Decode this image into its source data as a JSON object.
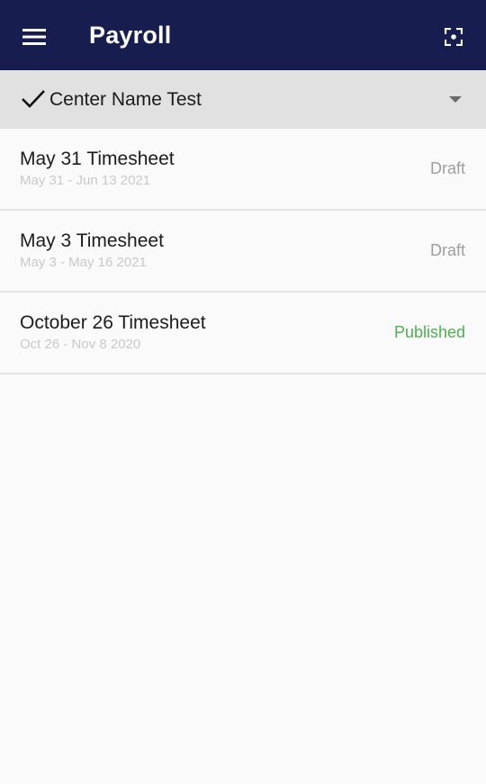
{
  "header": {
    "title": "Payroll",
    "menu_icon": "hamburger-menu-icon",
    "scan_icon": "scan-focus-icon",
    "background": "#171d4e"
  },
  "center_selector": {
    "label": "Center Name Test",
    "check_icon": "check-icon",
    "dropdown_icon": "dropdown-arrow-icon"
  },
  "timesheets": [
    {
      "title": "May 31 Timesheet",
      "range": "May 31 - Jun 13 2021",
      "status": "Draft",
      "status_color": "#9e9e9e"
    },
    {
      "title": "May 3 Timesheet",
      "range": "May 3 - May 16 2021",
      "status": "Draft",
      "status_color": "#9e9e9e"
    },
    {
      "title": "October 26 Timesheet",
      "range": "Oct 26 - Nov 8 2020",
      "status": "Published",
      "status_color": "#4caf50"
    }
  ]
}
